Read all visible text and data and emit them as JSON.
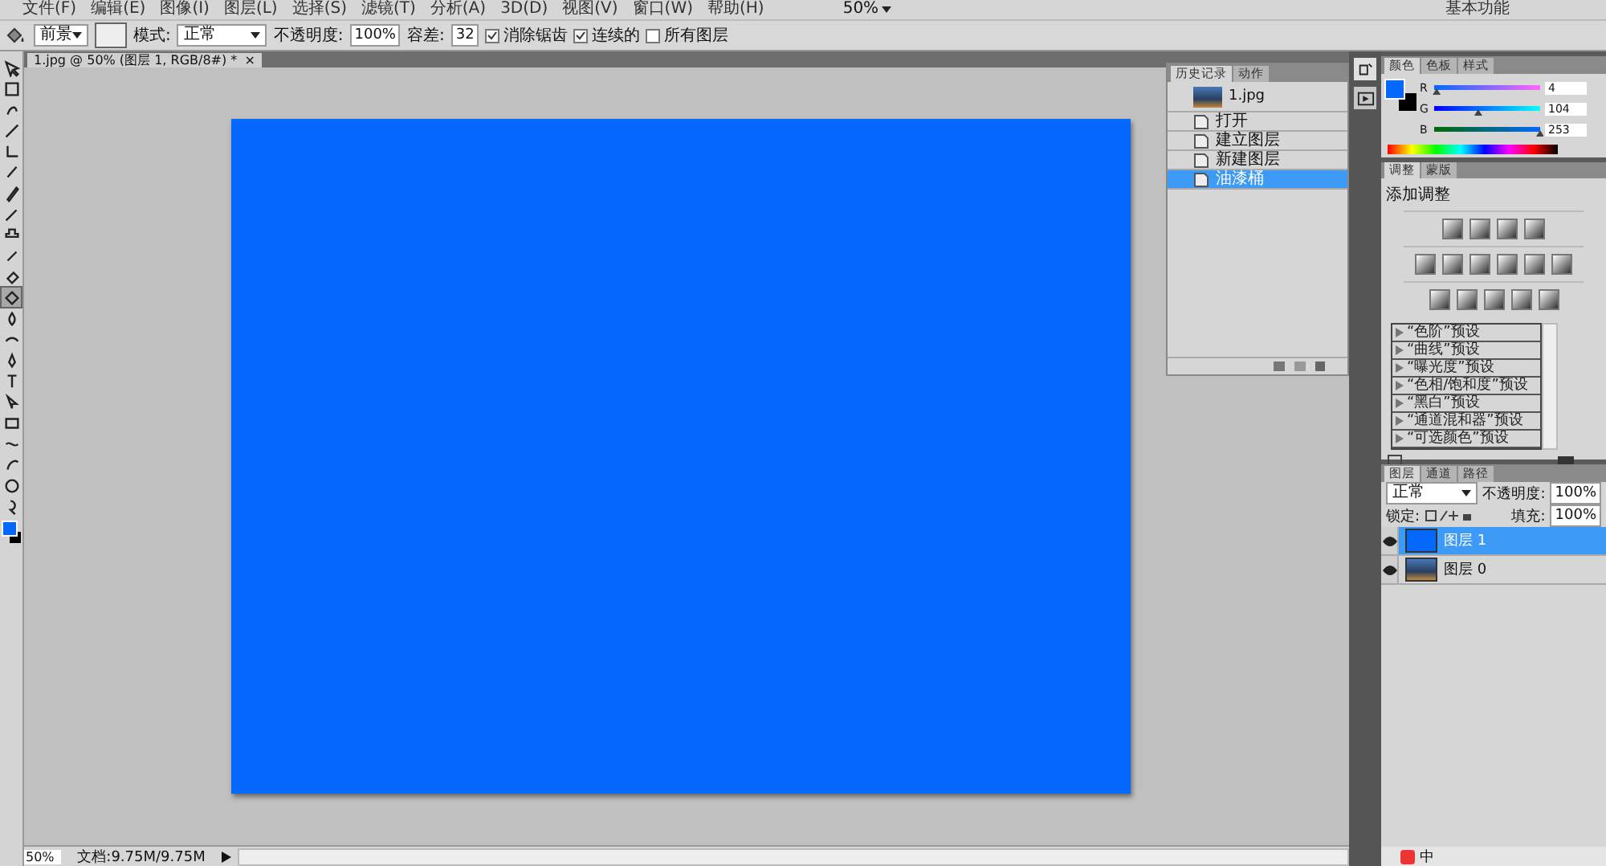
{
  "menu": [
    "文件(F)",
    "编辑(E)",
    "图像(I)",
    "图层(L)",
    "选择(S)",
    "滤镜(T)",
    "分析(A)",
    "3D(D)",
    "视图(V)",
    "窗口(W)",
    "帮助(H)"
  ],
  "zoom_menu": "50%",
  "workspace": "基本功能",
  "options": {
    "fill_source": "前景",
    "mode_label": "模式:",
    "mode": "正常",
    "opacity_label": "不透明度:",
    "opacity": "100%",
    "tolerance_label": "容差:",
    "tolerance": "32",
    "checks": [
      {
        "label": "消除锯齿",
        "checked": true
      },
      {
        "label": "连续的",
        "checked": true
      },
      {
        "label": "所有图层",
        "checked": false
      }
    ]
  },
  "document_tab": {
    "title": "1.jpg @ 50% (图层 1, RGB/8#) *",
    "close": "×"
  },
  "tools": [
    {
      "selected": false
    },
    {
      "selected": false
    },
    {
      "selected": false
    },
    {
      "selected": false
    },
    {
      "selected": false
    },
    {
      "selected": false
    },
    {
      "selected": false
    },
    {
      "selected": false
    },
    {
      "selected": false
    },
    {
      "selected": false
    },
    {
      "selected": false
    },
    {
      "selected": true
    },
    {
      "selected": false
    },
    {
      "selected": false
    },
    {
      "selected": false
    },
    {
      "selected": false
    },
    {
      "selected": false
    },
    {
      "selected": false
    },
    {
      "selected": false
    },
    {
      "selected": false
    },
    {
      "selected": false
    },
    {
      "selected": false
    }
  ],
  "history": {
    "tabs": [
      {
        "label": "历史记录",
        "selected": true
      },
      {
        "label": "动作",
        "selected": false
      }
    ],
    "snapshot": "1.jpg",
    "steps": [
      {
        "label": "打开",
        "selected": false
      },
      {
        "label": "建立图层",
        "selected": false
      },
      {
        "label": "新建图层",
        "selected": false
      },
      {
        "label": "油漆桶",
        "selected": true
      }
    ]
  },
  "color": {
    "tabs": [
      {
        "label": "颜色",
        "selected": true
      },
      {
        "label": "色板",
        "selected": false
      },
      {
        "label": "样式",
        "selected": false
      }
    ],
    "channels": [
      {
        "name": "R",
        "level": 0.016,
        "value": "4"
      },
      {
        "name": "G",
        "level": 0.408,
        "value": "104"
      },
      {
        "name": "B",
        "level": 0.992,
        "value": "253"
      }
    ]
  },
  "adjustments": {
    "tabs": [
      {
        "label": "调整",
        "selected": true
      },
      {
        "label": "蒙版",
        "selected": false
      }
    ],
    "title": "添加调整",
    "presets": [
      "“色阶”预设",
      "“曲线”预设",
      "“曝光度”预设",
      "“色相/饱和度”预设",
      "“黑白”预设",
      "“通道混和器”预设",
      "“可选颜色”预设"
    ]
  },
  "layers": {
    "tabs": [
      {
        "label": "图层",
        "selected": true
      },
      {
        "label": "通道",
        "selected": false
      },
      {
        "label": "路径",
        "selected": false
      }
    ],
    "blend_mode": "正常",
    "opacity_label": "不透明度:",
    "opacity": "100%",
    "lock_label": "锁定:",
    "fill_label": "填充:",
    "fill": "100%",
    "items": [
      {
        "name": "图层 1",
        "selected": true,
        "visible": true,
        "kind": "fill"
      },
      {
        "name": "图层 0",
        "selected": false,
        "visible": true,
        "kind": "photo"
      }
    ]
  },
  "status": {
    "zoom": "50%",
    "doc_info": "文档:9.75M/9.75M"
  },
  "tray": {
    "ime": "中"
  }
}
